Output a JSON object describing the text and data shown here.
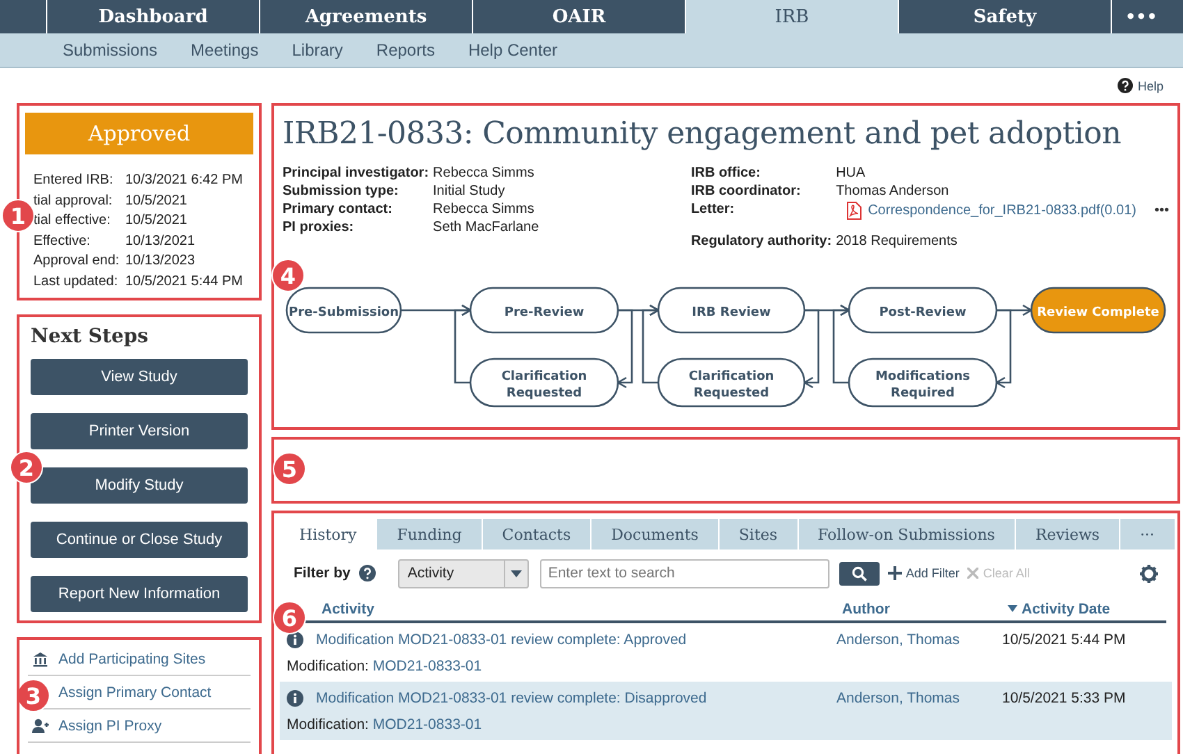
{
  "top_nav": [
    {
      "label": "Dashboard",
      "selected": false
    },
    {
      "label": "Agreements",
      "selected": false
    },
    {
      "label": "OAIR",
      "selected": false
    },
    {
      "label": "IRB",
      "selected": true
    },
    {
      "label": "Safety",
      "selected": false
    },
    {
      "label": "•••",
      "selected": false
    }
  ],
  "sub_nav": [
    "Submissions",
    "Meetings",
    "Library",
    "Reports",
    "Help Center"
  ],
  "help": "Help",
  "status": {
    "badge": "Approved",
    "fields": [
      {
        "label": "Entered IRB:",
        "value": "10/3/2021 6:42 PM"
      },
      {
        "label": "tial approval:",
        "value": "10/5/2021"
      },
      {
        "label": "tial effective:",
        "value": "10/5/2021"
      },
      {
        "label": "Effective:",
        "value": "10/13/2021"
      },
      {
        "label": "Approval end:",
        "value": "10/13/2023"
      },
      {
        "label": "Last updated:",
        "value": "10/5/2021 5:44 PM"
      }
    ]
  },
  "next_steps": {
    "title": "Next Steps",
    "buttons": [
      "View Study",
      "Printer Version",
      "Modify Study",
      "Continue or Close Study",
      "Report New Information"
    ]
  },
  "actions": [
    {
      "label": "Add Participating Sites",
      "kind": "building"
    },
    {
      "label": "Assign Primary Contact",
      "kind": "none"
    },
    {
      "label": "Assign PI Proxy",
      "kind": "person-add"
    }
  ],
  "study": {
    "title": "IRB21-0833: Community engagement and pet adoption",
    "left_fields": [
      {
        "label": "Principal investigator:",
        "value": "Rebecca Simms"
      },
      {
        "label": "Submission type:",
        "value": "Initial Study"
      },
      {
        "label": "Primary contact:",
        "value": "Rebecca Simms"
      },
      {
        "label": "PI proxies:",
        "value": "Seth MacFarlane"
      }
    ],
    "right_fields": [
      {
        "label": "IRB office:",
        "value": "HUA",
        "kind": "text"
      },
      {
        "label": "IRB coordinator:",
        "value": "Thomas Anderson",
        "kind": "text"
      },
      {
        "label": "Letter:",
        "value": "Correspondence_for_IRB21-0833.pdf(0.01)",
        "kind": "file",
        "more": "•••"
      },
      {
        "label": "Regulatory authority:",
        "value": "2018 Requirements",
        "kind": "text"
      }
    ]
  },
  "workflow": {
    "stages": [
      {
        "label": "Pre-Submission",
        "highlighted": false
      },
      {
        "label": "Pre-Review",
        "highlighted": false,
        "return_step": "Clarification Requested"
      },
      {
        "label": "IRB Review",
        "highlighted": false,
        "return_step": "Clarification Requested"
      },
      {
        "label": "Post-Review",
        "highlighted": false,
        "return_step": "Modifications Required"
      },
      {
        "label": "Review Complete",
        "highlighted": true
      }
    ]
  },
  "history": {
    "tabs": [
      {
        "label": "History",
        "selected": true
      },
      {
        "label": "Funding",
        "selected": false
      },
      {
        "label": "Contacts",
        "selected": false
      },
      {
        "label": "Documents",
        "selected": false
      },
      {
        "label": "Sites",
        "selected": false
      },
      {
        "label": "Follow-on Submissions",
        "selected": false
      },
      {
        "label": "Reviews",
        "selected": false
      },
      {
        "label": "···",
        "selected": false
      }
    ],
    "filter": {
      "label": "Filter by",
      "select": "Activity",
      "placeholder": "Enter text to search",
      "add": "Add Filter",
      "clear": "Clear All",
      "clear_disabled": true
    },
    "columns": [
      {
        "label": "Activity",
        "sorted": false
      },
      {
        "label": "Author",
        "sorted": false
      },
      {
        "label": "Activity Date",
        "sorted": true
      }
    ],
    "rows": [
      {
        "activity": "Modification MOD21-0833-01 review complete: Approved",
        "author": "Anderson, Thomas",
        "date": "10/5/2021 5:44 PM",
        "detail_label": "Modification:",
        "detail_link": "MOD21-0833-01",
        "selected": false
      },
      {
        "activity": "Modification MOD21-0833-01 review complete: Disapproved",
        "author": "Anderson, Thomas",
        "date": "10/5/2021 5:33 PM",
        "detail_label": "Modification:",
        "detail_link": "MOD21-0833-01",
        "selected": true
      }
    ]
  },
  "callouts": [
    "1",
    "2",
    "3",
    "4",
    "5",
    "6"
  ]
}
